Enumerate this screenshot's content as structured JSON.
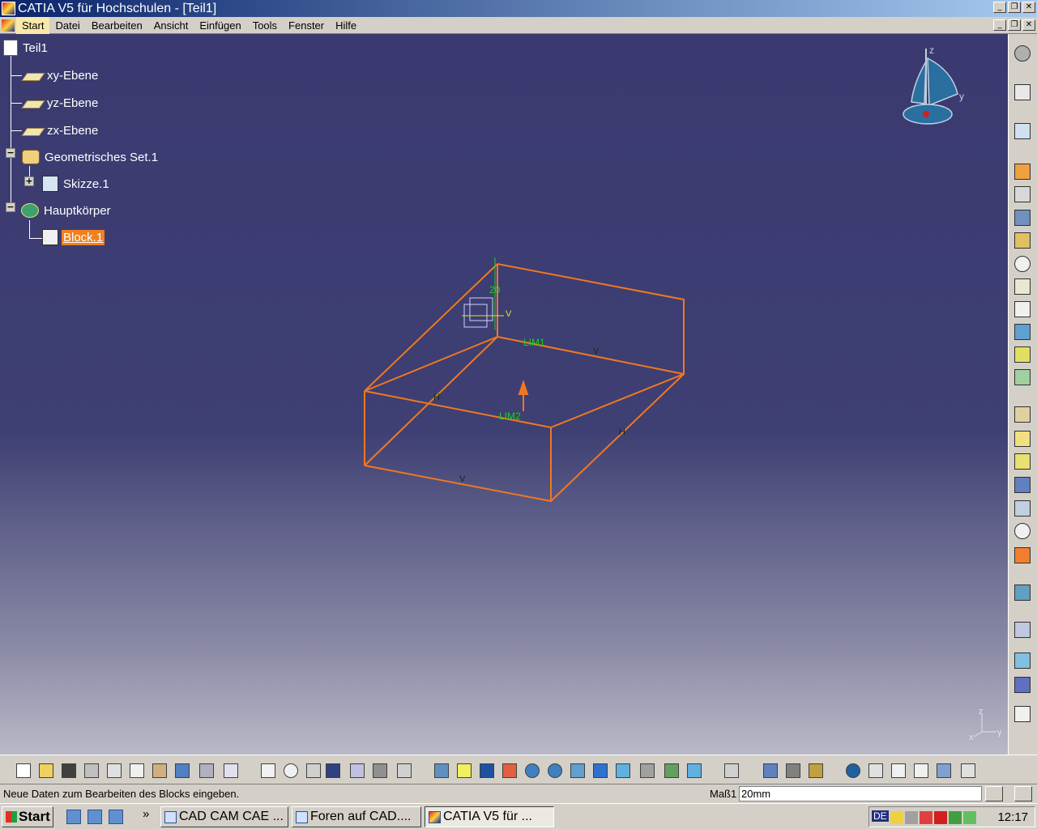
{
  "window": {
    "title": "CATIA V5 für Hochschulen - [Teil1]",
    "buttons": {
      "minimize": "_",
      "restore": "❐",
      "close": "✕"
    }
  },
  "menu": {
    "items": [
      "Start",
      "Datei",
      "Bearbeiten",
      "Ansicht",
      "Einfügen",
      "Tools",
      "Fenster",
      "Hilfe"
    ]
  },
  "tree": {
    "root": "Teil1",
    "planes": [
      "xy-Ebene",
      "yz-Ebene",
      "zx-Ebene"
    ],
    "geo_set": "Geometrisches Set.1",
    "sketch": "Skizze.1",
    "body": "Hauptkörper",
    "feature": "Block.1",
    "expander_minus": "−",
    "expander_plus": "+"
  },
  "viewport": {
    "labels": {
      "dim": "20",
      "lim1": "LIM1",
      "lim2": "LIM2",
      "v": "V",
      "h": "H",
      "axis_v": "V"
    },
    "compass": {
      "z": "z",
      "y": "y"
    },
    "axes": {
      "z": "z",
      "y": "y",
      "x": "x"
    },
    "colors": {
      "wire": "#f07820",
      "label": "#20d020",
      "compass": "#2a6fa0"
    }
  },
  "status": {
    "message": "Neue Daten zum Bearbeiten des Blocks eingeben.",
    "field_label": "Maß1",
    "field_value": "20mm"
  },
  "taskbar": {
    "start": "Start",
    "more": "»",
    "tasks": [
      {
        "label": "CAD CAM CAE ...",
        "active": false
      },
      {
        "label": "Foren auf CAD....",
        "active": false
      },
      {
        "label": "CATIA V5 für ...",
        "active": true
      }
    ],
    "lang": "DE",
    "clock": "12:17"
  },
  "toolbar_icons": {
    "bottom": [
      "new-file-icon",
      "open-file-icon",
      "save-icon",
      "print-icon",
      "cut-icon",
      "copy-icon",
      "paste-icon",
      "undo-icon",
      "redo-icon",
      "whats-this-icon",
      "formula-icon",
      "comment-icon",
      "knowledge-icon",
      "table-icon",
      "graph-tree-icon",
      "lock-icon",
      "reorder-icon",
      "fly-mode-icon",
      "fit-all-icon",
      "pan-icon",
      "rotate-icon",
      "zoom-in-icon",
      "zoom-out-icon",
      "normal-view-icon",
      "multi-view-icon",
      "iso-view-icon",
      "shading-icon",
      "hide-show-icon",
      "swap-visible-icon",
      "measure-icon",
      "measure-between-icon",
      "measure-inertia-icon",
      "material-icon",
      "update-icon",
      "hand-icon",
      "axis-system-icon",
      "grid-icon",
      "constraint-icon",
      "analysis-icon"
    ],
    "right": [
      "settings-icon",
      "select-icon",
      "sketcher-icon",
      "pad-icon",
      "pocket-icon",
      "shaft-icon",
      "groove-icon",
      "hole-icon",
      "rib-icon",
      "slot-icon",
      "stiffener-icon",
      "loft-icon",
      "remove-loft-icon",
      "fillet-icon",
      "chamfer-icon",
      "draft-icon",
      "shell-icon",
      "thickness-icon",
      "thread-icon",
      "translate-icon",
      "mirror-icon",
      "pattern-icon",
      "scale-icon",
      "split-icon",
      "boolean-icon",
      "annotation-icon",
      "view-icon"
    ]
  }
}
